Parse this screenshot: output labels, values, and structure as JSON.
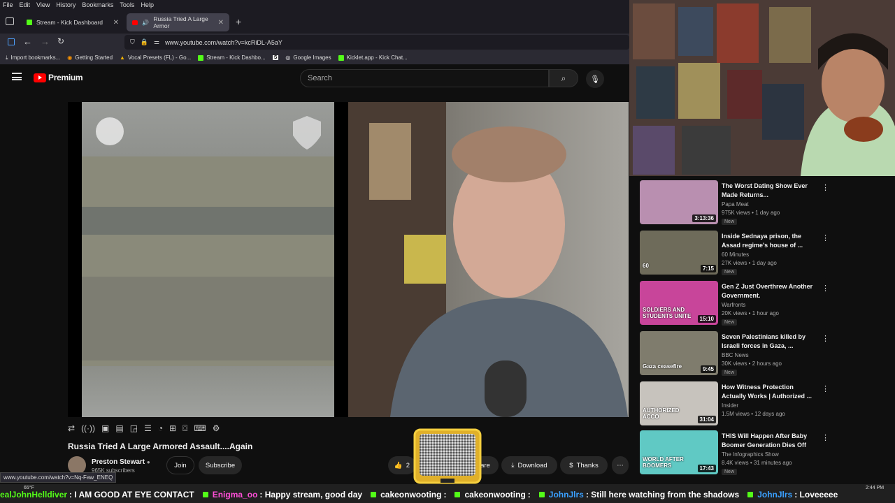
{
  "menubar": [
    "File",
    "Edit",
    "View",
    "History",
    "Bookmarks",
    "Tools",
    "Help"
  ],
  "tabs": [
    {
      "title": "Stream - Kick Dashboard",
      "active": false
    },
    {
      "title": "Russia Tried A Large Armor",
      "active": true
    }
  ],
  "url": "www.youtube.com/watch?v=kcRiDL-A5aY",
  "bookmarks": [
    "Import bookmarks...",
    "Getting Started",
    "Vocal Presets (FL) - Go...",
    "Stream - Kick Dashbo...",
    "Google Images",
    "Kicklet.app - Kick Chat..."
  ],
  "youtube": {
    "logo_text": "Premium",
    "search_placeholder": "Search",
    "video_title": "Russia Tried A Large Armored Assault....Again",
    "channel_name": "Preston Stewart",
    "subscribers": "965K subscribers",
    "join_label": "Join",
    "subscribe_label": "Subscribe",
    "likes": "2",
    "share_label": "are",
    "download_label": "Download",
    "thanks_label": "Thanks"
  },
  "recommendations": [
    {
      "title": "The Worst Dating Show Ever Made Returns...",
      "channel": "Papa Meat",
      "meta": "975K views • 1 day ago",
      "duration": "3:13:36",
      "badge": "New",
      "thumb_color": "#b98fb0"
    },
    {
      "title": "Inside Sednaya prison, the Assad regime's house of ...",
      "channel": "60 Minutes",
      "meta": "27K views • 1 day ago",
      "duration": "7:15",
      "badge": "New",
      "thumb_color": "#6e6b5a",
      "overlay": "60"
    },
    {
      "title": "Gen Z Just Overthrew Another Government.",
      "channel": "Warfronts",
      "meta": "20K views • 1 hour ago",
      "duration": "15:10",
      "badge": "New",
      "thumb_color": "#c8459a",
      "overlay": "SOLDIERS AND STUDENTS UNITE"
    },
    {
      "title": "Seven Palestinians killed by Israeli forces in Gaza, ...",
      "channel": "BBC News",
      "meta": "30K views • 2 hours ago",
      "duration": "9:45",
      "badge": "New",
      "thumb_color": "#7f7c6d",
      "overlay": "Gaza ceasefire"
    },
    {
      "title": "How Witness Protection Actually Works | Authorized ...",
      "channel": "Insider",
      "meta": "1.5M views • 12 days ago",
      "duration": "31:04",
      "badge": "",
      "thumb_color": "#c7c3bd",
      "overlay": "AUTHORIZED ACCO"
    },
    {
      "title": "THIS Will Happen After Baby Boomer Generation Dies Off",
      "channel": "The Infographics Show",
      "meta": "8.4K views • 31 minutes ago",
      "duration": "17:43",
      "badge": "New",
      "thumb_color": "#60c9c4",
      "overlay": "WORLD AFTER BOOMERS"
    }
  ],
  "status_url": "www.youtube.com/watch?v=Nq-Faw_ENEQ",
  "weather": "65°F",
  "clock": "2:44 PM",
  "chat": [
    {
      "name": "ealJohnHelldiver",
      "msg": ": I AM GOOD AT EYE CONTACT",
      "color": "#53fc18"
    },
    {
      "name": "Enigma_oo",
      "msg": ": Happy stream, good day",
      "color": "#ff4fd8"
    },
    {
      "name": "cakeonwooting",
      "msg": ":",
      "color": "#ffffff"
    },
    {
      "name": "cakeonwooting",
      "msg": ":",
      "color": "#ffffff"
    },
    {
      "name": "JohnJlrs",
      "msg": ": Still here watching from the shadows",
      "color": "#3aa0ff"
    },
    {
      "name": "JohnJlrs",
      "msg": ": Loveeeee",
      "color": "#3aa0ff"
    }
  ]
}
